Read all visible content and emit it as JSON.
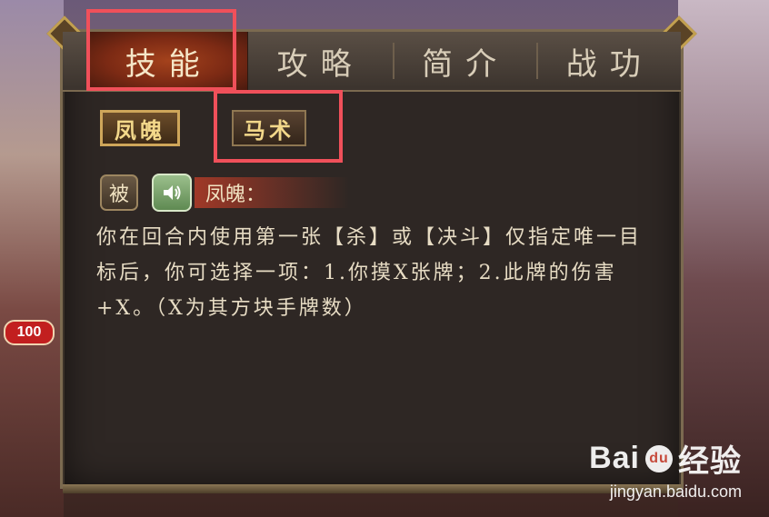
{
  "badge": {
    "level": "100"
  },
  "tabs": [
    {
      "label": "技能",
      "active": true
    },
    {
      "label": "攻略",
      "active": false
    },
    {
      "label": "简介",
      "active": false
    },
    {
      "label": "战功",
      "active": false
    }
  ],
  "skills": {
    "buttons": [
      {
        "label": "凤魄",
        "selected": true
      },
      {
        "label": "马术",
        "selected": false
      }
    ]
  },
  "skill_detail": {
    "type_badge": "被",
    "speaker_icon": "speaker-icon",
    "title": "凤魄：",
    "description": "你在回合内使用第一张【杀】或【决斗】仅指定唯一目标后，你可选择一项：1.你摸X张牌；2.此牌的伤害+X。（X为其方块手牌数）"
  },
  "watermark": {
    "brand": "Bai",
    "brand_tail": "经验",
    "url": "jingyan.baidu.com"
  },
  "colors": {
    "active_tab": "#7c2a14",
    "highlight": "#f0505a",
    "gold_text": "#f3d88a"
  }
}
